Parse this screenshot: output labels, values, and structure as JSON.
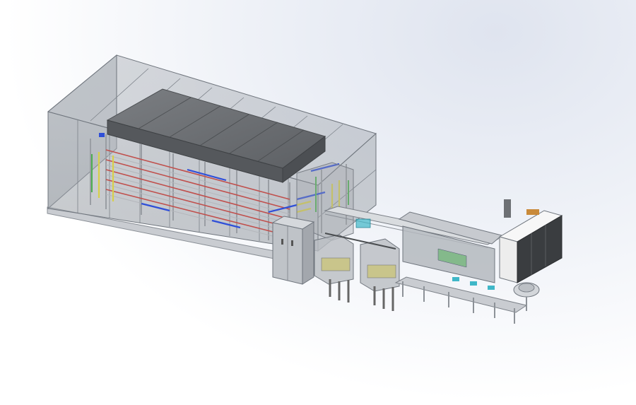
{
  "viewport": {
    "background_top": "#dfe4ef",
    "background_bottom": "#ffffff"
  },
  "colors": {
    "enclosure_glass": "#9aa0a8",
    "enclosure_edge": "#6f757d",
    "machine_dark": "#6a6d70",
    "rack_red": "#c0504d",
    "rack_blue": "#2f4fd8",
    "rack_yellow": "#d8d04a",
    "rack_green": "#4caf50",
    "cabinet_white": "#f2f2f2",
    "cabinet_dark": "#3a3d40",
    "frame_gray": "#b8bcc2",
    "accent_cyan": "#3fb7c8"
  },
  "scene": {
    "subject": "cad-assembly-isometric",
    "components": [
      "glass-enclosure",
      "multi-tier-conveyor-rack",
      "control-cabinet",
      "transfer-conveyor",
      "filling-stations",
      "packaging-line-frame",
      "electrical-cabinet",
      "rotary-table"
    ]
  }
}
